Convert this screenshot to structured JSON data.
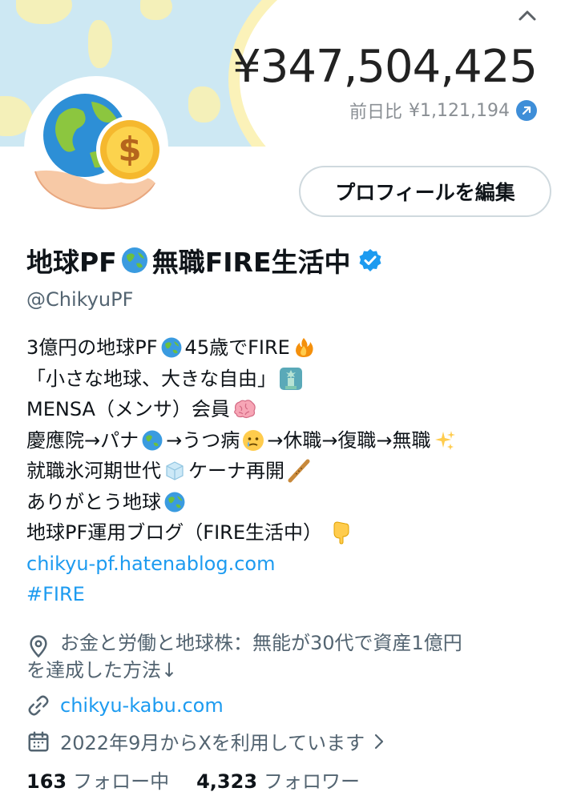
{
  "banner": {
    "balance": "¥347,504,425",
    "diff_label": "前日比",
    "diff_value": "¥1,121,194",
    "diff_icon": "arrow-up-right-icon",
    "collapse_icon": "chevron-up-icon"
  },
  "profile": {
    "edit_button": "プロフィールを編集",
    "name_part1": "地球PF",
    "name_part2": "無職FIRE生活中",
    "handle": "@ChikyuPF",
    "verified_icon": "verified-badge-icon"
  },
  "bio": {
    "line1a": "3億円の地球PF",
    "line1b": " 45歳でFIRE",
    "line2": "「小さな地球、大きな自由」",
    "line3": "MENSA（メンサ）会員",
    "line4a": "慶應院→パナ",
    "line4b": "→うつ病",
    "line4c": "→休職→復職→無職",
    "line5a": "就職氷河期世代",
    "line5b": " ケーナ再開",
    "line6": "ありがとう地球",
    "line7": "地球PF運用ブログ（FIRE生活中）",
    "link": "chikyu-pf.hatenablog.com",
    "hashtag": "#FIRE"
  },
  "meta": {
    "location_line1": "お金と労働と地球株：無能が30代で資産1億円",
    "location_line2": "を達成した方法↓",
    "website": "chikyu-kabu.com",
    "joined": "2022年9月からXを利用しています"
  },
  "follows": {
    "following_count": "163",
    "following_label": "フォロー中",
    "followers_count": "4,323",
    "followers_label": "フォロワー"
  },
  "colors": {
    "link": "#1d9bf0",
    "secondary_text": "#536471",
    "banner_bg": "#cde8f3",
    "banner_accent": "#fbf2b9",
    "verified": "#1d9bf0"
  }
}
